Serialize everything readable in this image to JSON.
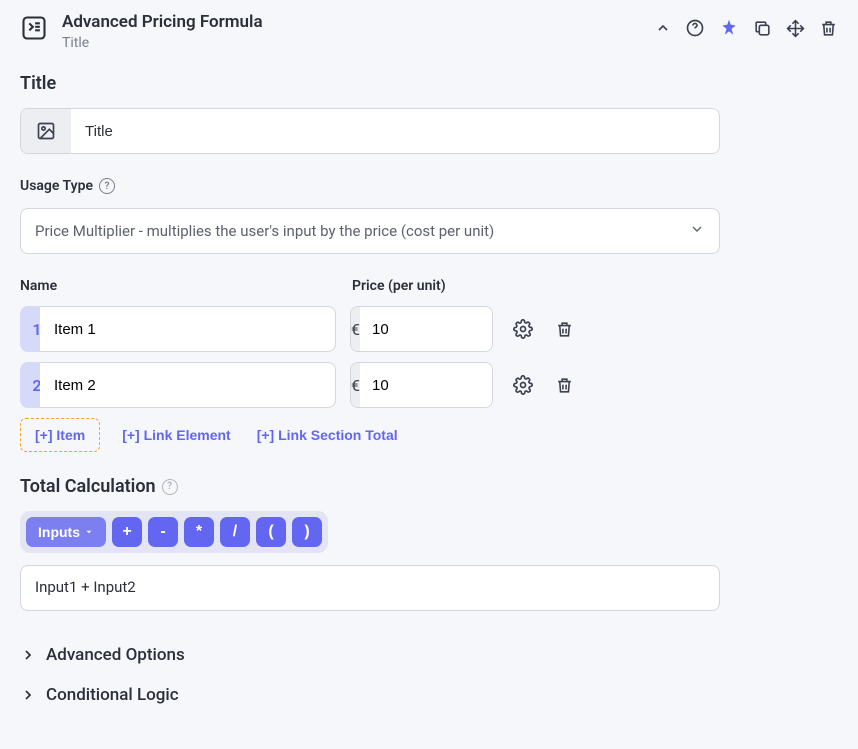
{
  "header": {
    "title": "Advanced Pricing Formula",
    "subtitle": "Title"
  },
  "title_section": {
    "label": "Title",
    "value": "Title"
  },
  "usage_type": {
    "label": "Usage Type",
    "selected": "Price Multiplier - multiplies the user's input by the price (cost per unit)"
  },
  "items": {
    "name_label": "Name",
    "price_label": "Price (per unit)",
    "currency": "€",
    "rows": [
      {
        "num": "1",
        "name": "Item 1",
        "price": "10"
      },
      {
        "num": "2",
        "name": "Item 2",
        "price": "10"
      }
    ],
    "add_item": "[+] Item",
    "link_element": "[+] Link Element",
    "link_section_total": "[+] Link Section Total"
  },
  "calc": {
    "label": "Total Calculation",
    "inputs_btn": "Inputs",
    "ops": {
      "plus": "+",
      "minus": "-",
      "mult": "*",
      "div": "/",
      "lpar": "(",
      "rpar": ")"
    },
    "formula": "Input1 + Input2"
  },
  "accordion": {
    "advanced": "Advanced Options",
    "conditional": "Conditional Logic"
  }
}
